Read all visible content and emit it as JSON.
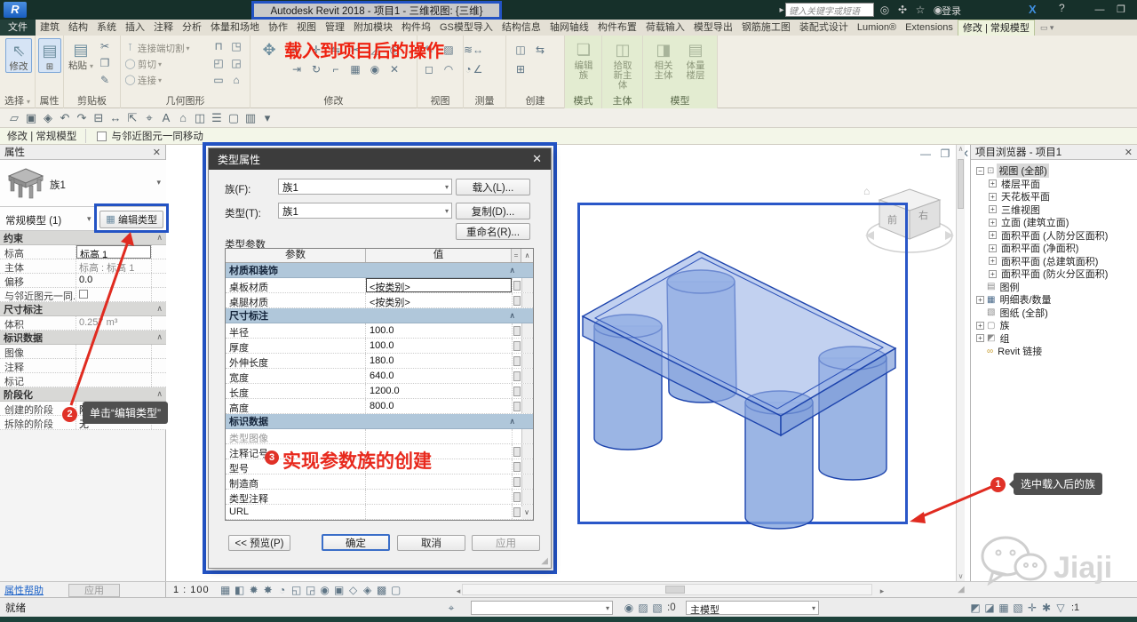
{
  "title_bar": {
    "app_title": "Autodesk Revit 2018 -   项目1 - 三维视图: {三维}",
    "search_placeholder": "键入关键字或短语",
    "sign_in": "登录"
  },
  "ribbon_tabs": [
    "文件",
    "建筑",
    "结构",
    "系统",
    "插入",
    "注释",
    "分析",
    "体量和场地",
    "协作",
    "视图",
    "管理",
    "附加模块",
    "构件坞",
    "GS模型导入",
    "结构信息",
    "轴网轴线",
    "构件布置",
    "荷载输入",
    "模型导出",
    "钢筋施工图",
    "装配式设计",
    "Lumion®",
    "Extensions",
    "修改 | 常规模型"
  ],
  "ribbon": {
    "active_tab": "修改 | 常规模型",
    "modify_button": "修改",
    "properties_button": "属性",
    "paste_button": "粘贴",
    "geometry_items": [
      "连接端切割",
      "剪切",
      "连接"
    ],
    "mode_button_lines": [
      "编辑",
      "族"
    ],
    "host_button_lines": [
      "拾取",
      "新主体"
    ],
    "model_button1_lines": [
      "相关",
      "主体"
    ],
    "model_button2_lines": [
      "体量",
      "楼层"
    ],
    "panel_labels": [
      "选择",
      "属性",
      "剪贴板",
      "几何图形",
      "修改",
      "视图",
      "测量",
      "创建",
      "模式",
      "主体",
      "模型"
    ]
  },
  "options_bar": {
    "context": "修改 | 常规模型",
    "move_with_nearby": "与邻近图元一同移动"
  },
  "properties_panel": {
    "title": "属性",
    "family": "族1",
    "type_selector": "常规模型 (1)",
    "edit_type": "编辑类型",
    "sections": [
      {
        "header": "约束",
        "rows": [
          {
            "label": "标高",
            "value": "标高 1",
            "style": "edit"
          },
          {
            "label": "主体",
            "value": "标高 : 标高 1",
            "style": "gray"
          },
          {
            "label": "偏移",
            "value": "0.0",
            "style": ""
          },
          {
            "label": "与邻近图元一同...",
            "value": "",
            "style": "checkbox"
          }
        ]
      },
      {
        "header": "尺寸标注",
        "rows": [
          {
            "label": "体积",
            "value": "0.257 m³",
            "style": "gray"
          }
        ]
      },
      {
        "header": "标识数据",
        "rows": [
          {
            "label": "图像",
            "value": "",
            "style": ""
          },
          {
            "label": "注释",
            "value": "",
            "style": ""
          },
          {
            "label": "标记",
            "value": "",
            "style": ""
          }
        ]
      },
      {
        "header": "阶段化",
        "rows": [
          {
            "label": "创建的阶段",
            "value": "阶段 1",
            "style": ""
          },
          {
            "label": "拆除的阶段",
            "value": "无",
            "style": ""
          }
        ]
      }
    ],
    "help": "属性帮助",
    "apply": "应用"
  },
  "type_dialog": {
    "title": "类型属性",
    "family_label": "族(F):",
    "family_value": "族1",
    "type_label": "类型(T):",
    "type_value": "族1",
    "load": "载入(L)...",
    "duplicate": "复制(D)...",
    "rename": "重命名(R)...",
    "type_params": "类型参数",
    "col_param": "参数",
    "col_value": "值",
    "groups": [
      {
        "name": "材质和装饰",
        "rows": [
          {
            "label": "桌板材质",
            "value": "<按类别>",
            "selected": true,
            "assoc": true
          },
          {
            "label": "桌腿材质",
            "value": "<按类别>",
            "assoc": true
          }
        ]
      },
      {
        "name": "尺寸标注",
        "rows": [
          {
            "label": "半径",
            "value": "100.0",
            "assoc": true
          },
          {
            "label": "厚度",
            "value": "100.0",
            "assoc": true
          },
          {
            "label": "外伸长度",
            "value": "180.0",
            "assoc": true
          },
          {
            "label": "宽度",
            "value": "640.0",
            "assoc": true
          },
          {
            "label": "长度",
            "value": "1200.0",
            "assoc": true
          },
          {
            "label": "高度",
            "value": "800.0",
            "assoc": true
          }
        ]
      },
      {
        "name": "标识数据",
        "rows": [
          {
            "label": "类型图像",
            "value": "",
            "gray": true
          },
          {
            "label": "注释记号",
            "value": "",
            "assoc": true
          },
          {
            "label": "型号",
            "value": "",
            "assoc": true
          },
          {
            "label": "制造商",
            "value": "",
            "assoc": true
          },
          {
            "label": "类型注释",
            "value": "",
            "assoc": true
          },
          {
            "label": "URL",
            "value": "",
            "assoc": true
          }
        ]
      }
    ],
    "preview": "<< 预览(P)",
    "ok": "确定",
    "cancel": "取消",
    "apply": "应用"
  },
  "project_browser": {
    "title": "项目浏览器 - 项目1",
    "tree": [
      {
        "label": "视图 (全部)",
        "depth": 0,
        "exp": "minus",
        "icon": "views",
        "selected": true
      },
      {
        "label": "楼层平面",
        "depth": 1,
        "exp": "plus"
      },
      {
        "label": "天花板平面",
        "depth": 1,
        "exp": "plus"
      },
      {
        "label": "三维视图",
        "depth": 1,
        "exp": "plus"
      },
      {
        "label": "立面 (建筑立面)",
        "depth": 1,
        "exp": "plus"
      },
      {
        "label": "面积平面 (人防分区面积)",
        "depth": 1,
        "exp": "plus"
      },
      {
        "label": "面积平面 (净面积)",
        "depth": 1,
        "exp": "plus"
      },
      {
        "label": "面积平面 (总建筑面积)",
        "depth": 1,
        "exp": "plus"
      },
      {
        "label": "面积平面 (防火分区面积)",
        "depth": 1,
        "exp": "plus"
      },
      {
        "label": "图例",
        "depth": 0,
        "exp": "none",
        "icon": "legend"
      },
      {
        "label": "明细表/数量",
        "depth": 0,
        "exp": "plus",
        "icon": "schedule"
      },
      {
        "label": "图纸 (全部)",
        "depth": 0,
        "exp": "none",
        "icon": "sheet"
      },
      {
        "label": "族",
        "depth": 0,
        "exp": "plus",
        "icon": "family"
      },
      {
        "label": "组",
        "depth": 0,
        "exp": "plus",
        "icon": "group"
      },
      {
        "label": "Revit 链接",
        "depth": 0,
        "exp": "none",
        "icon": "link"
      }
    ]
  },
  "viewcube": {
    "front": "前",
    "right": "右"
  },
  "view_bar": {
    "scale": "1 : 100"
  },
  "status_bar": {
    "ready": "就绪",
    "requests": ":0",
    "design_option": "主模型",
    "filter_count": ":1"
  },
  "annotations": {
    "ribbon_note": "载入到项目后的操作",
    "steps": [
      {
        "num": "1",
        "text": "选中载入后的族"
      },
      {
        "num": "2",
        "text": "单击“编辑类型”"
      },
      {
        "num": "3",
        "text": "实现参数族的创建"
      }
    ]
  },
  "watermark": "Jiaji",
  "colors": {
    "annotation_blue": "#2353c4",
    "annotation_red": "#e8291d",
    "selection_blue": "#2a57c8",
    "model_fill": "#89a7e0"
  },
  "icons": {
    "qat": [
      {
        "n": "open",
        "g": "▱"
      },
      {
        "n": "save",
        "g": "▣"
      },
      {
        "n": "sync-3d",
        "g": "◈"
      },
      {
        "n": "undo",
        "g": "↶"
      },
      {
        "n": "redo",
        "g": "↷"
      },
      {
        "n": "print",
        "g": "⊟"
      },
      {
        "n": "measure",
        "g": "↔"
      },
      {
        "n": "aligned-dimension",
        "g": "⇱"
      },
      {
        "n": "tag",
        "g": "⌖"
      },
      {
        "n": "text",
        "g": "A"
      },
      {
        "n": "default-3d-view",
        "g": "⌂"
      },
      {
        "n": "section",
        "g": "◫"
      },
      {
        "n": "thin-lines",
        "g": "☰"
      },
      {
        "n": "close-hidden-windows",
        "g": "▢"
      },
      {
        "n": "user-interface",
        "g": "▥"
      },
      {
        "n": "qat-more",
        "g": "▾"
      }
    ],
    "clipboard_small": [
      {
        "n": "cut",
        "g": "✂"
      },
      {
        "n": "copy",
        "g": "❐"
      },
      {
        "n": "match-properties",
        "g": "✎"
      }
    ],
    "geometry_right": [
      {
        "n": "cope",
        "g": "⊓"
      },
      {
        "n": "wall-opening",
        "g": "◰"
      },
      {
        "n": "paint",
        "g": "▭"
      },
      {
        "n": "demolish",
        "g": "◳"
      },
      {
        "n": "split-face",
        "g": "◲"
      },
      {
        "n": "align-geom",
        "g": "⌂"
      }
    ],
    "modify_panel": [
      {
        "n": "align",
        "g": "⇤"
      },
      {
        "n": "offset",
        "g": "⇥"
      },
      {
        "n": "move",
        "g": "✛"
      },
      {
        "n": "rotate",
        "g": "↻"
      },
      {
        "n": "mirror",
        "g": "⇋"
      },
      {
        "n": "trim",
        "g": "⌐"
      },
      {
        "n": "split",
        "g": "✂"
      },
      {
        "n": "array",
        "g": "▦"
      },
      {
        "n": "scale",
        "g": "◿"
      },
      {
        "n": "pin",
        "g": "◉"
      },
      {
        "n": "unpin",
        "g": "◎"
      },
      {
        "n": "delete",
        "g": "✕"
      }
    ],
    "view_panel": [
      {
        "n": "override-graphics",
        "g": "✎"
      },
      {
        "n": "hide-elements",
        "g": "◻"
      },
      {
        "n": "override-category",
        "g": "▨"
      },
      {
        "n": "displace",
        "g": "◠"
      },
      {
        "n": "linework",
        "g": "≋"
      },
      {
        "n": "cut-profile",
        "g": "◔"
      }
    ],
    "measure_panel": [
      {
        "n": "measure-between",
        "g": "↔"
      },
      {
        "n": "angular-dimension",
        "g": "∠"
      }
    ],
    "create_panel": [
      {
        "n": "create-similar",
        "g": "◫"
      },
      {
        "n": "create-group",
        "g": "⊞"
      },
      {
        "n": "create-assembly",
        "g": "⇆"
      }
    ],
    "viewbar_icons": [
      {
        "n": "detail-level",
        "g": "▦"
      },
      {
        "n": "visual-style",
        "g": "◧"
      },
      {
        "n": "sun-path",
        "g": "✹"
      },
      {
        "n": "shadows",
        "g": "✸"
      },
      {
        "n": "rendering",
        "g": "◔"
      },
      {
        "n": "crop-view",
        "g": "◱"
      },
      {
        "n": "show-crop",
        "g": "◲"
      },
      {
        "n": "reveal-hidden",
        "g": "◉"
      },
      {
        "n": "temporary-hide",
        "g": "▣"
      },
      {
        "n": "analytical-model",
        "g": "◇"
      },
      {
        "n": "reveal-constraints",
        "g": "◈"
      },
      {
        "n": "worksharing-display",
        "g": "▩"
      },
      {
        "n": "temporary-properties",
        "g": "▢"
      }
    ],
    "title_cluster": [
      {
        "n": "search",
        "g": "◎"
      },
      {
        "n": "communication-center",
        "g": "✣"
      },
      {
        "n": "favorites",
        "g": "☆"
      },
      {
        "n": "account",
        "g": "◉"
      }
    ],
    "win_ctrl": [
      {
        "n": "minimize",
        "g": "—"
      },
      {
        "n": "restore",
        "g": "❐"
      },
      {
        "n": "close",
        "g": "✕"
      }
    ],
    "view_win_ctrl": [
      {
        "n": "view-minimize",
        "g": "—"
      },
      {
        "n": "view-restore",
        "g": "❐"
      },
      {
        "n": "view-close",
        "g": "✕"
      }
    ],
    "status_right": [
      {
        "n": "select-links",
        "g": "◩"
      },
      {
        "n": "select-underlay",
        "g": "◪"
      },
      {
        "n": "select-pinned",
        "g": "▦"
      },
      {
        "n": "select-by-face",
        "g": "▧"
      },
      {
        "n": "drag-selection",
        "g": "✛"
      },
      {
        "n": "background-processes",
        "g": "✱"
      },
      {
        "n": "filter",
        "g": "▽"
      }
    ],
    "status_mid": [
      {
        "n": "worksets",
        "g": "◉"
      },
      {
        "n": "save-local",
        "g": "▨"
      },
      {
        "n": "sync-central",
        "g": "▧"
      }
    ]
  }
}
